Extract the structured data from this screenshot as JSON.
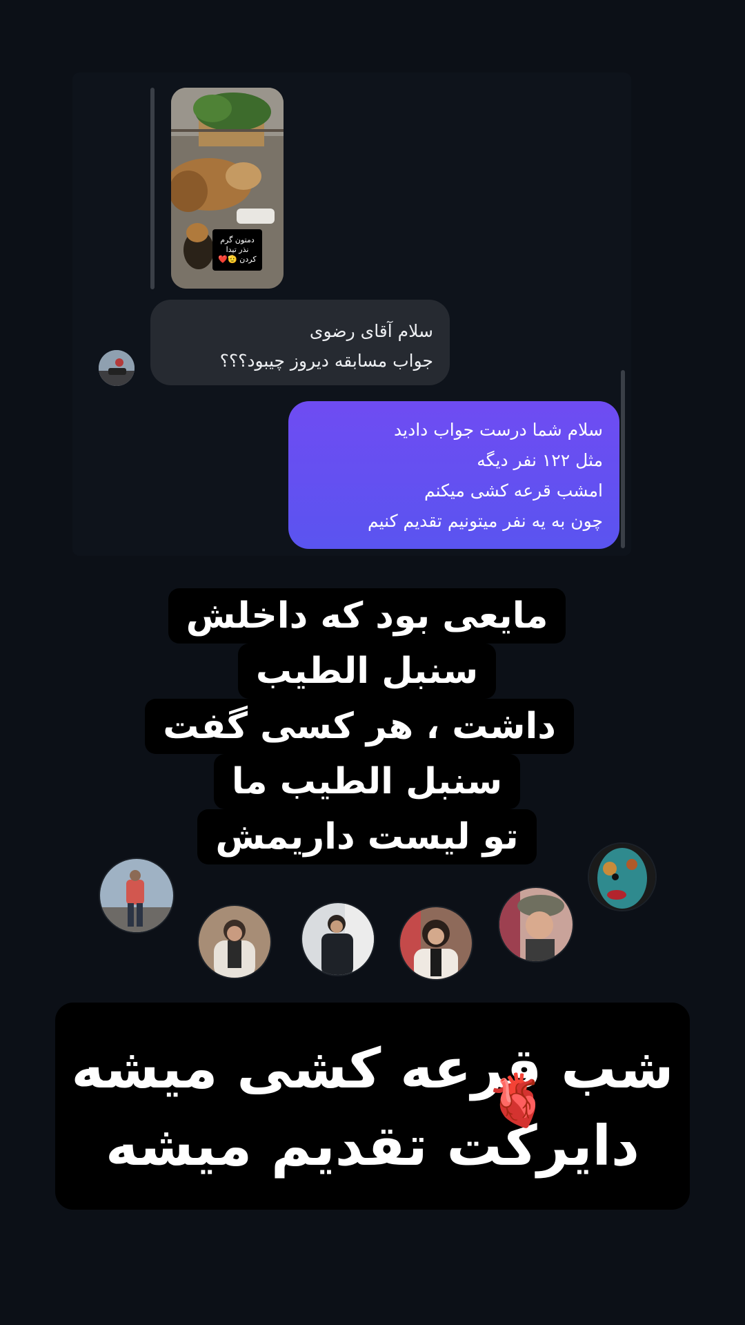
{
  "story_reply": {
    "caption_lines": [
      "دمتون گرم",
      "نذر تیدا",
      "کردن 🫡❤️"
    ]
  },
  "messages": {
    "incoming": {
      "lines": [
        "سلام آقای رضوی",
        "جواب مسابقه دیروز چیبود؟؟؟"
      ]
    },
    "outgoing": {
      "lines": [
        "سلام شما درست جواب دادید",
        "مثل ۱۲۲ نفر دیگه",
        "امشب قرعه کشی میکنم",
        "چون به یه نفر میتونیم تقدیم کنیم"
      ]
    }
  },
  "overlay_text": {
    "quote_lines": [
      "مایعی بود که داخلش",
      "سنبل الطیب",
      "داشت ، هر کسی گفت",
      "سنبل الطیب ما",
      "تو لیست داریمش"
    ],
    "banner_lines": [
      "شب قرعه کشی میشه",
      "دایرکت تقدیم میشه"
    ],
    "heart_sticker": "🫀"
  },
  "colors": {
    "background": "#0c1017",
    "incoming_bubble": "#262a31",
    "outgoing_bubble": "#6f4cf2"
  }
}
